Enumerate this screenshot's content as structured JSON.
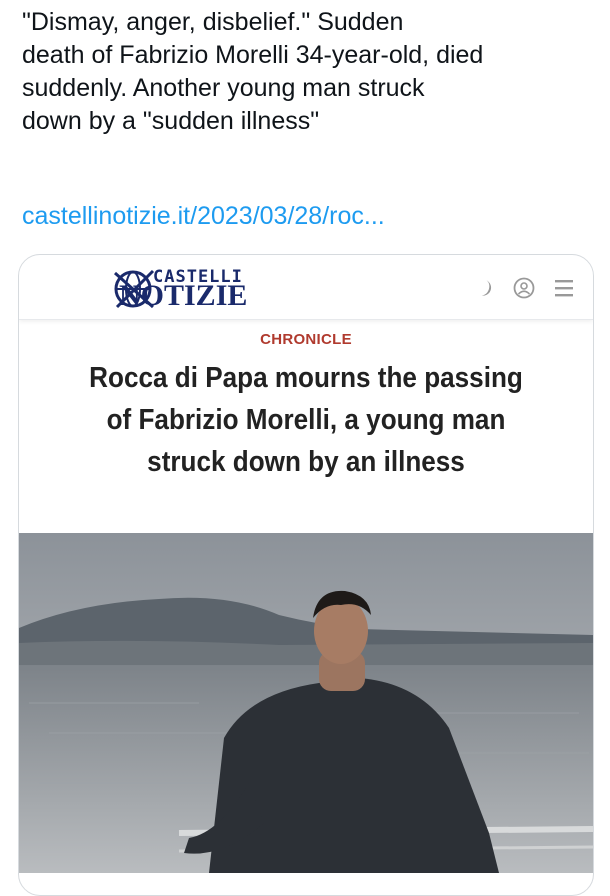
{
  "tweet": {
    "text": "\"Dismay, anger, disbelief.\" Sudden\ndeath of Fabrizio Morelli 34-year-old, died\nsuddenly. Another young man struck\ndown by a \"sudden illness\"",
    "link": "castellinotizie.it/2023/03/28/roc..."
  },
  "card": {
    "logo": {
      "top": "CASTELLI",
      "bottom": "NOTIZIE"
    },
    "header_icons": [
      "moon-icon",
      "user-icon",
      "menu-icon"
    ],
    "section": "CHRONICLE",
    "headline": "Rocca di Papa mourns the passing\nof Fabrizio Morelli, a young man\nstruck down by an illness"
  },
  "colors": {
    "link": "#1d9bf0",
    "section": "#b03a2e",
    "logo": "#1a2a6b"
  }
}
